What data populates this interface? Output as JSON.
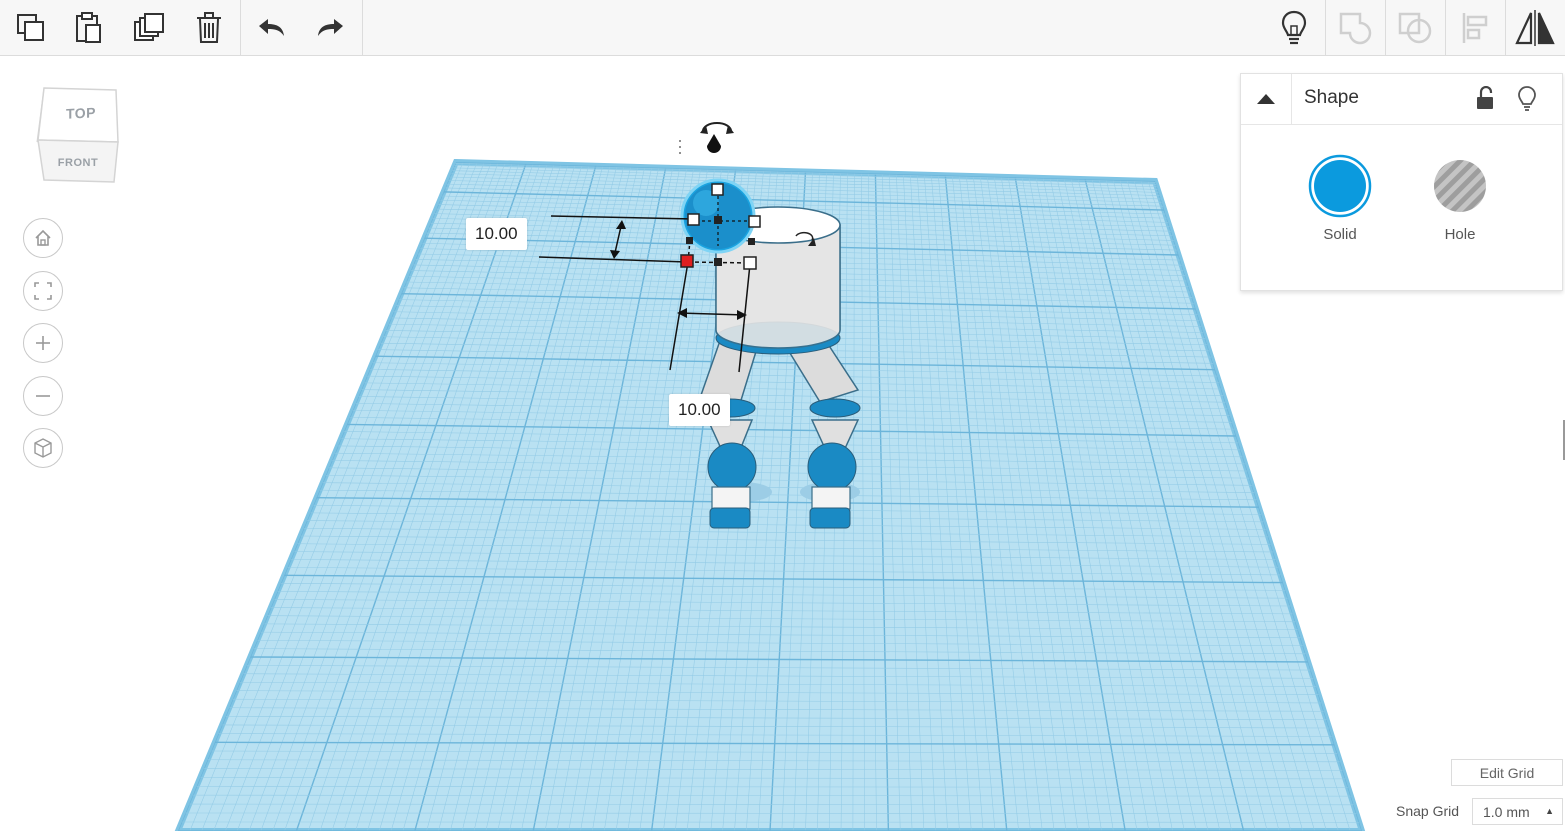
{
  "toolbar": {
    "left_tools": [
      "copy-icon",
      "paste-icon",
      "duplicate-icon",
      "trash-icon",
      "undo-icon",
      "redo-icon"
    ],
    "right_tools": [
      "lightbulb-icon",
      "group-icon",
      "ungroup-icon",
      "align-icon",
      "mirror-icon"
    ]
  },
  "viewcube": {
    "top": "TOP",
    "front": "FRONT"
  },
  "nav": [
    "home-icon",
    "fit-view-icon",
    "zoom-in-icon",
    "zoom-out-icon",
    "perspective-icon"
  ],
  "dimensions": {
    "height": "10.00",
    "width": "10.00"
  },
  "panel": {
    "title": "Shape",
    "solid_label": "Solid",
    "hole_label": "Hole",
    "solid_color": "#0b9ade",
    "hole_color": "#9e9e9e"
  },
  "grid": {
    "edit_label": "Edit Grid",
    "snap_label": "Snap Grid",
    "snap_value": "1.0 mm",
    "color": "#a9d8ee"
  }
}
